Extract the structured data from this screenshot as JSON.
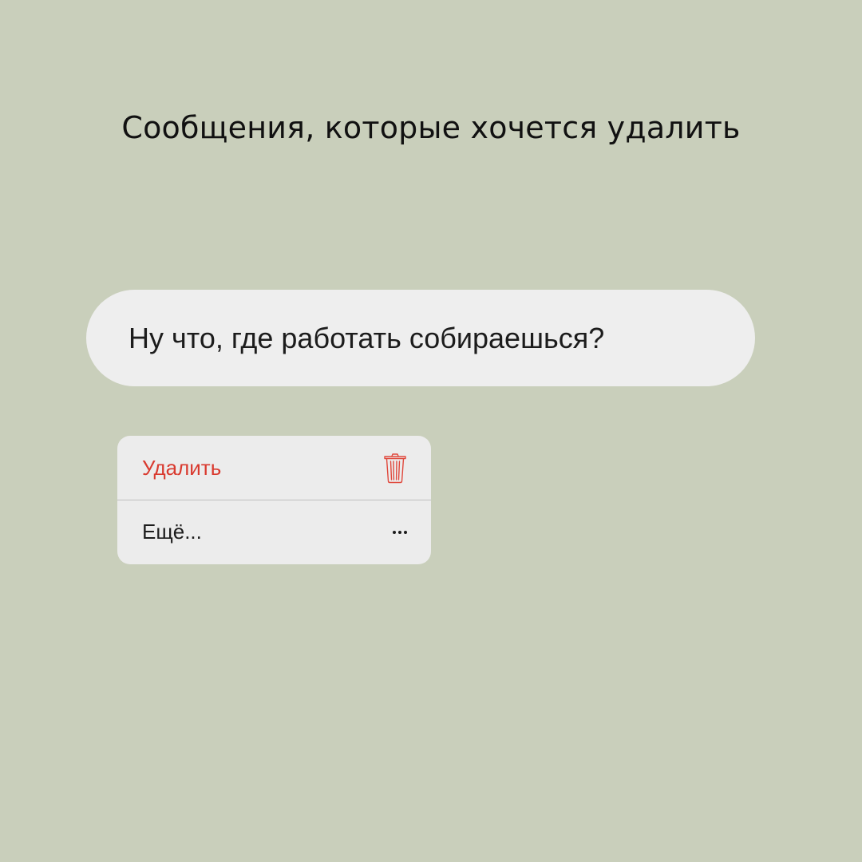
{
  "title": "Сообщения, которые хочется удалить",
  "message": {
    "text": "Ну что, где работать собираешься?"
  },
  "context_menu": {
    "items": [
      {
        "label": "Удалить",
        "icon": "trash-icon",
        "color": "#d93a2f"
      },
      {
        "label": "Ещё...",
        "icon": "more-dots-icon",
        "color": "#1c1c1c"
      }
    ]
  },
  "colors": {
    "background": "#c9cfbb",
    "bubble": "#eeeeee",
    "menu": "#ececec",
    "destructive": "#d93a2f"
  }
}
